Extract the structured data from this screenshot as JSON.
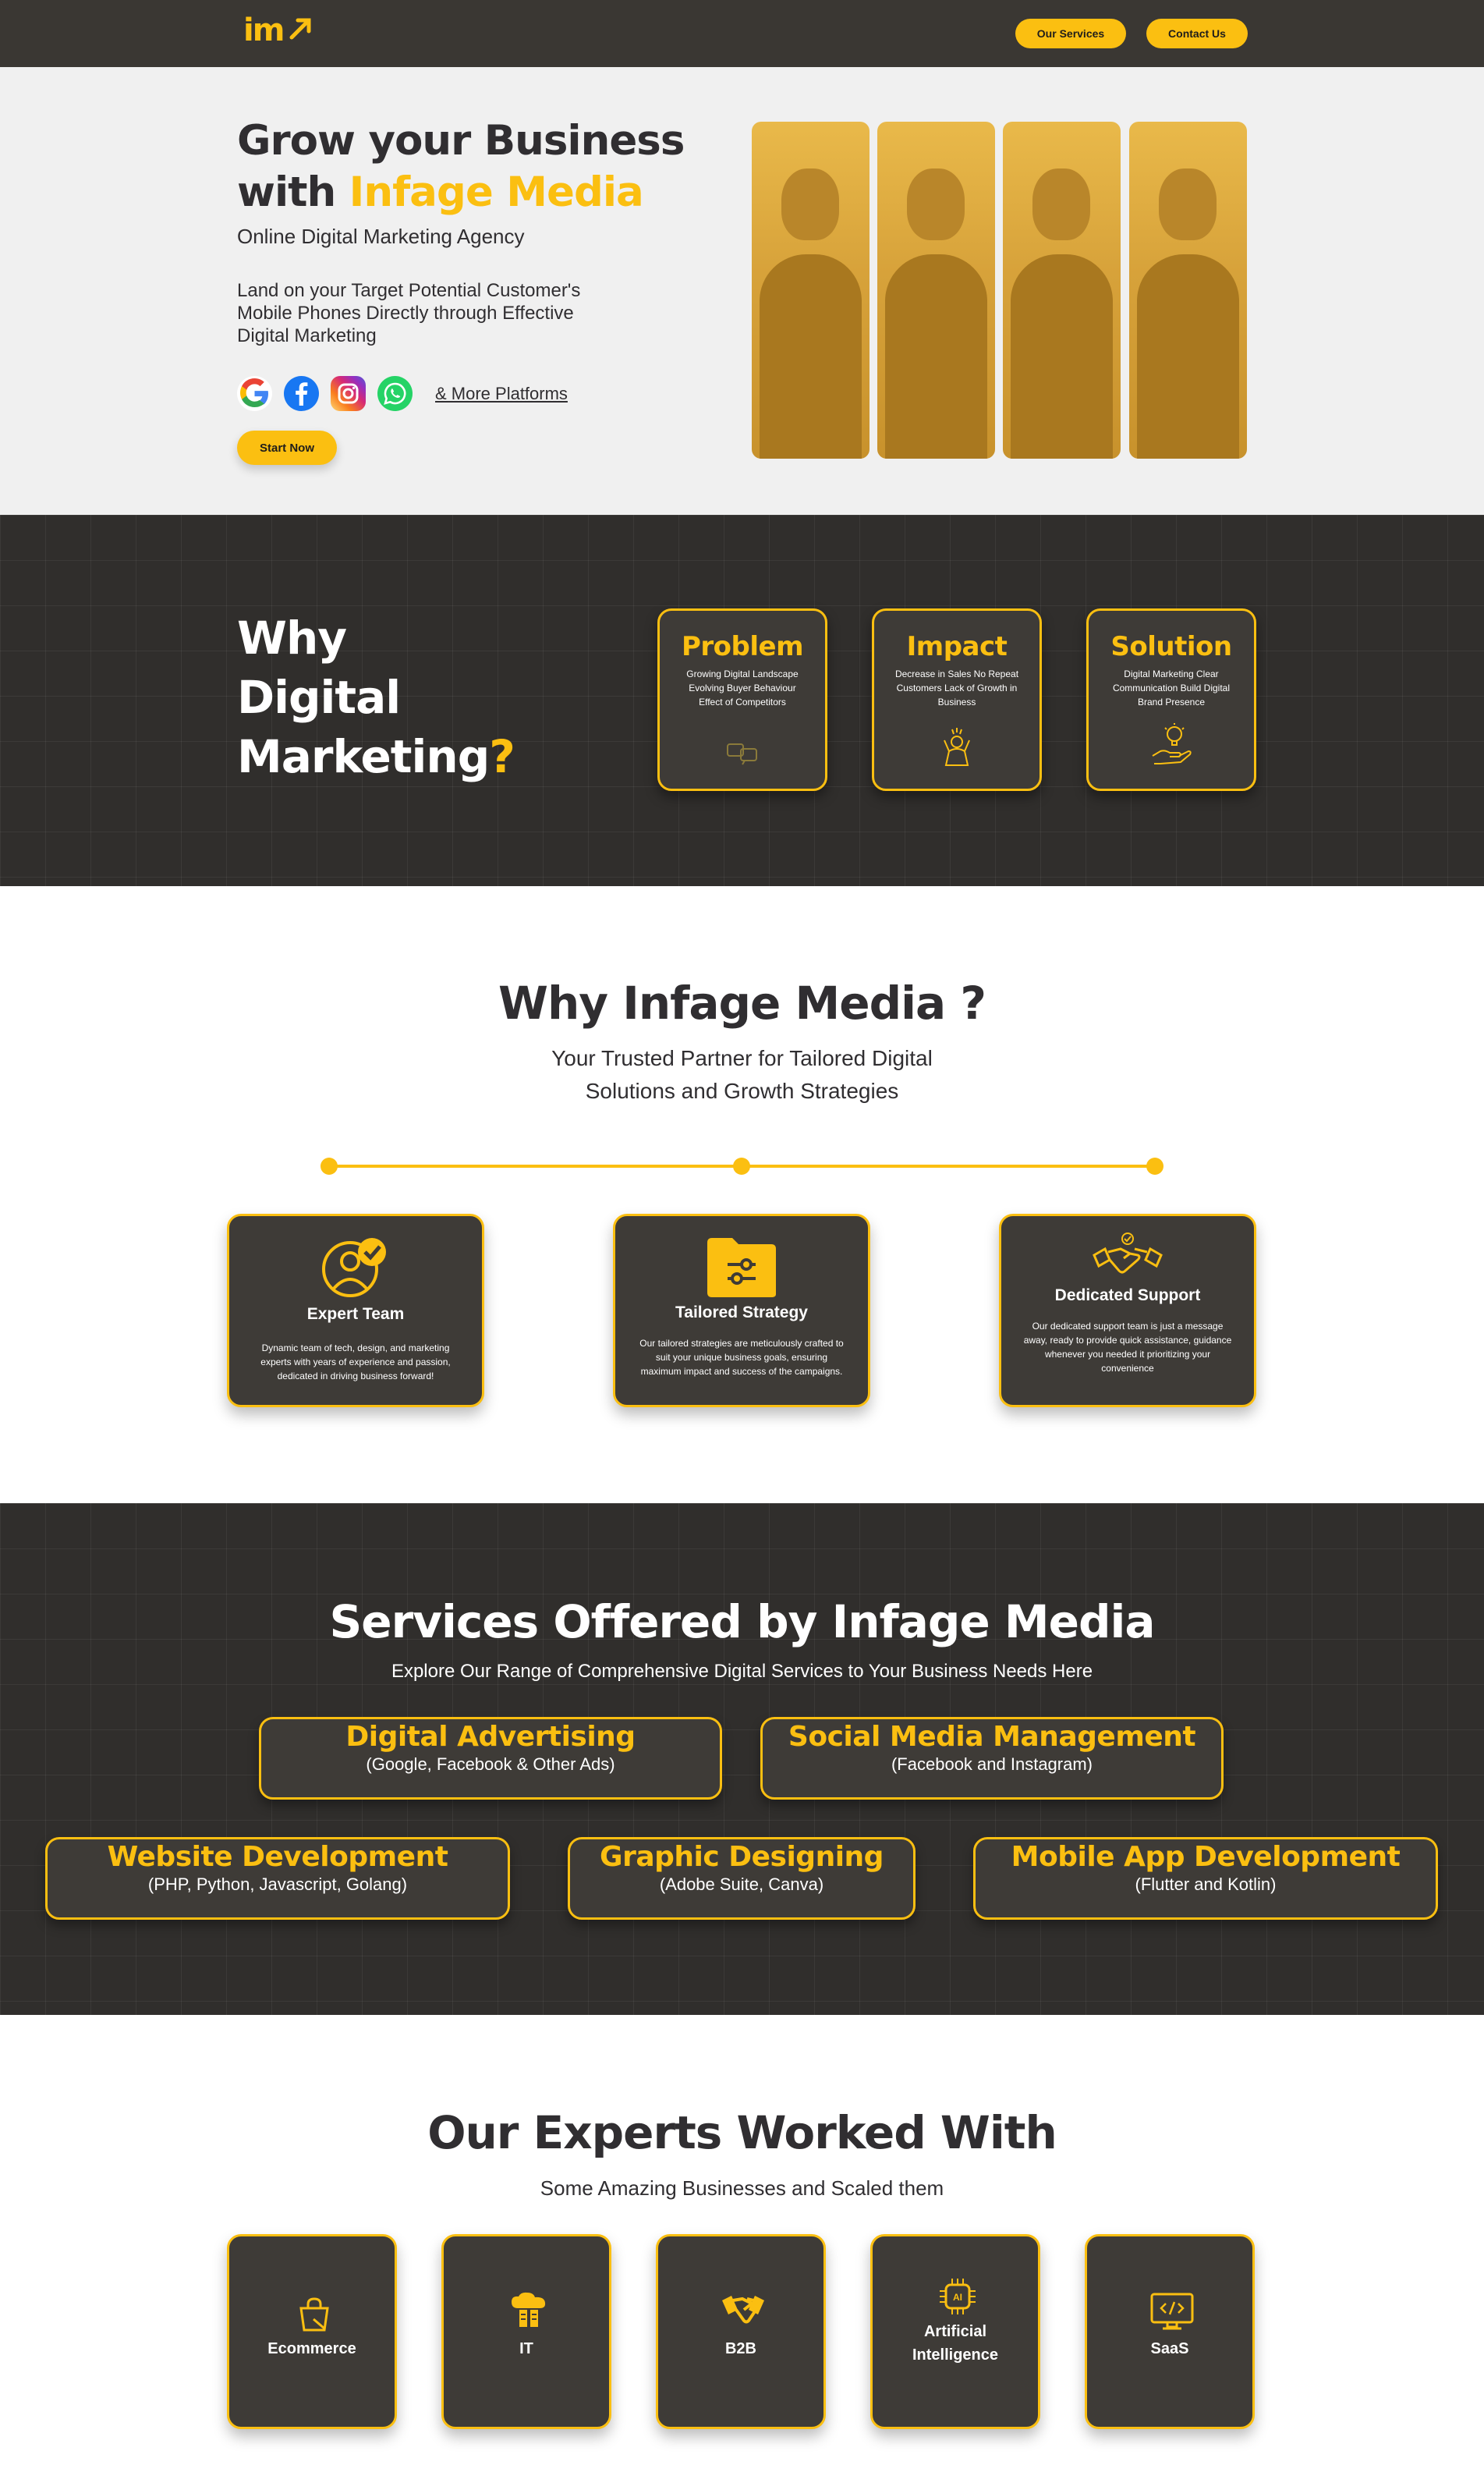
{
  "nav": {
    "logo": "im",
    "buttons": [
      "Our Services",
      "Contact Us"
    ]
  },
  "hero": {
    "title_line1": "Grow your Business",
    "title_with": "with ",
    "title_highlight": "Infage Media",
    "subtitle": "Online Digital Marketing Agency",
    "description": "Land on your Target Potential Customer's Mobile Phones Directly through Effective Digital Marketing",
    "platform_icons": [
      "google-icon",
      "facebook-icon",
      "instagram-icon",
      "whatsapp-icon"
    ],
    "more_platforms": "& More Platforms",
    "cta": "Start Now"
  },
  "why_digital": {
    "title_l1": "Why",
    "title_l2": "Digital",
    "title_l3": "Marketing",
    "title_q": "?",
    "cards": [
      {
        "title": "Problem",
        "text": "Growing Digital Landscape Evolving Buyer Behaviour Effect of Competitors",
        "icon": "chat-bubbles-icon"
      },
      {
        "title": "Impact",
        "text": "Decrease in Sales No Repeat Customers Lack of Growth in Business",
        "icon": "stressed-person-icon"
      },
      {
        "title": "Solution",
        "text": "Digital Marketing Clear Communication Build Digital Brand Presence",
        "icon": "idea-hand-icon"
      }
    ]
  },
  "why_infage": {
    "title": "Why Infage Media ?",
    "subtitle_l1": "Your Trusted Partner for Tailored Digital",
    "subtitle_l2": "Solutions and Growth Strategies",
    "cards": [
      {
        "title": "Expert Team",
        "text": "Dynamic team of tech, design, and marketing experts with years of experience and passion, dedicated in driving business forward!",
        "icon": "expert-team-icon"
      },
      {
        "title": "Tailored Strategy",
        "text": "Our tailored strategies are meticulously crafted to suit your unique business goals, ensuring maximum impact and success of the campaigns.",
        "icon": "folder-settings-icon"
      },
      {
        "title": "Dedicated Support",
        "text": "Our dedicated support team is just a message away, ready to provide quick assistance, guidance whenever you needed it prioritizing your convenience",
        "icon": "handshake-icon"
      }
    ]
  },
  "services": {
    "title": "Services Offered by Infage Media",
    "subtitle": "Explore Our Range of Comprehensive Digital Services to Your Business Needs Here",
    "items": [
      {
        "title": "Digital Advertising",
        "detail": "(Google, Facebook & Other Ads)"
      },
      {
        "title": "Social Media Management",
        "detail": "(Facebook and Instagram)"
      },
      {
        "title": "Website Development",
        "detail": "(PHP, Python, Javascript, Golang)"
      },
      {
        "title": "Graphic Designing",
        "detail": "(Adobe Suite, Canva)"
      },
      {
        "title": "Mobile App Development",
        "detail": "(Flutter and Kotlin)"
      }
    ]
  },
  "experts": {
    "title": "Our Experts Worked With",
    "subtitle": "Some Amazing Businesses and Scaled them",
    "items": [
      {
        "label": "Ecommerce",
        "icon": "shopping-bag-icon"
      },
      {
        "label": "IT",
        "icon": "cloud-server-icon"
      },
      {
        "label": "B2B",
        "icon": "handshake-icon"
      },
      {
        "label_l1": "Artificial",
        "label_l2": "Intelligence",
        "icon": "ai-chip-icon"
      },
      {
        "label": "SaaS",
        "icon": "code-monitor-icon"
      }
    ]
  },
  "colors": {
    "accent": "#fbbf11",
    "dark": "#302e2c",
    "card": "#3e3b37",
    "text": "#302e31"
  }
}
